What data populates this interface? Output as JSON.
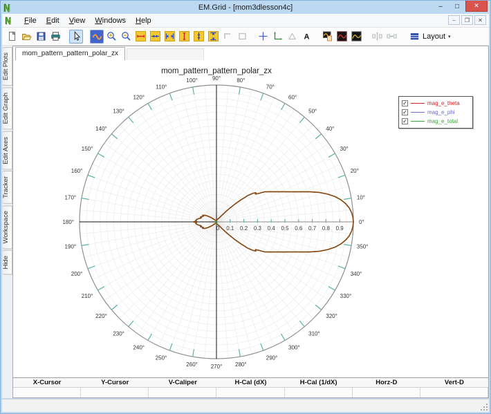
{
  "window": {
    "title": "EM.Grid - [mom3dlesson4c]"
  },
  "menu": {
    "items": [
      "File",
      "Edit",
      "View",
      "Windows",
      "Help"
    ]
  },
  "toolbar": {
    "layout_label": "Layout",
    "buttons": [
      {
        "icon": "new-document"
      },
      {
        "icon": "open-folder"
      },
      {
        "icon": "save"
      },
      {
        "icon": "print"
      },
      {
        "sep": true
      },
      {
        "icon": "pointer",
        "selected": true
      },
      {
        "sep": true
      },
      {
        "icon": "plot-trace",
        "dark": true
      },
      {
        "icon": "zoom-in"
      },
      {
        "icon": "zoom-out"
      },
      {
        "icon": "expand-x"
      },
      {
        "icon": "shrink-x"
      },
      {
        "icon": "fit-x"
      },
      {
        "icon": "expand-y"
      },
      {
        "icon": "shrink-y"
      },
      {
        "icon": "fit-y"
      },
      {
        "icon": "corner-box",
        "disabled": true
      },
      {
        "icon": "rect-box",
        "disabled": true
      },
      {
        "sep": true
      },
      {
        "icon": "crosshair"
      },
      {
        "icon": "axes"
      },
      {
        "icon": "triangle",
        "disabled": true
      },
      {
        "icon": "text-a"
      },
      {
        "sep": true
      },
      {
        "icon": "copy-plot"
      },
      {
        "icon": "plot-red"
      },
      {
        "icon": "plot-olive"
      },
      {
        "sep": true
      },
      {
        "icon": "align-v",
        "disabled": true
      },
      {
        "icon": "align-h",
        "disabled": true
      },
      {
        "sep": true
      },
      {
        "icon": "layout",
        "is_layout": true
      }
    ]
  },
  "sidebar": {
    "tabs": [
      "Edit Plots",
      "Edit Graph",
      "Edit Axes",
      "Tracker",
      "Workspace",
      "Hide"
    ]
  },
  "document_tab": {
    "label": "mom_pattern_pattern_polar_zx"
  },
  "chart_data": {
    "type": "polar",
    "title": "mom_pattern_pattern_polar_zx",
    "angle_unit": "degrees",
    "angle_tick_step_deg": 10,
    "spoke_step_deg": 5,
    "radial_range": [
      0,
      1
    ],
    "radial_grid_step": 0.05,
    "radial_tick_labels": [
      "0",
      "0.1",
      "0.2",
      "0.3",
      "0.4",
      "0.5",
      "0.6",
      "0.7",
      "0.8",
      "0.9"
    ],
    "angle_labels": [
      "0°",
      "10°",
      "20°",
      "30°",
      "40°",
      "50°",
      "60°",
      "70°",
      "80°",
      "90°",
      "100°",
      "110°",
      "120°",
      "130°",
      "140°",
      "150°",
      "160°",
      "170°",
      "180°",
      "190°",
      "200°",
      "210°",
      "220°",
      "230°",
      "240°",
      "250°",
      "260°",
      "270°",
      "280°",
      "290°",
      "300°",
      "310°",
      "320°",
      "330°",
      "340°",
      "350°"
    ],
    "grid_color": "#e9e9e9",
    "rim_color": "#8f8f8f",
    "tick_color": "#58b2a6",
    "legend": {
      "position": "top-right",
      "entries": [
        {
          "label": "mag_e_theta",
          "color": "#d42222",
          "checked": true
        },
        {
          "label": "mag_e_phi",
          "color": "#6b6bc8",
          "checked": true
        },
        {
          "label": "mag_e_total",
          "color": "#3aa33a",
          "checked": true
        }
      ]
    },
    "series": [
      {
        "name": "mag_e_total",
        "rendered_color": "#3aa33a",
        "same_points_as": "mag_e_theta"
      },
      {
        "name": "mag_e_theta",
        "rendered_color": "#8b4513",
        "symmetric_about_deg": 0,
        "points_deg_r": [
          [
            0,
            1.0
          ],
          [
            2,
            0.997
          ],
          [
            4,
            0.989
          ],
          [
            6,
            0.975
          ],
          [
            8,
            0.953
          ],
          [
            10,
            0.924
          ],
          [
            12,
            0.886
          ],
          [
            14,
            0.838
          ],
          [
            16,
            0.78
          ],
          [
            18,
            0.712
          ],
          [
            20,
            0.643
          ],
          [
            22,
            0.587
          ],
          [
            24,
            0.541
          ],
          [
            26,
            0.502
          ],
          [
            28,
            0.469
          ],
          [
            30,
            0.44
          ],
          [
            32,
            0.415
          ],
          [
            34,
            0.37
          ],
          [
            35.5,
            0.35
          ],
          [
            36.5,
            0.358
          ],
          [
            38,
            0.34
          ],
          [
            40,
            0.3
          ],
          [
            42,
            0.24
          ],
          [
            44,
            0.185
          ],
          [
            46,
            0.135
          ],
          [
            48,
            0.095
          ],
          [
            50,
            0.068
          ],
          [
            53,
            0.045
          ],
          [
            56,
            0.034
          ],
          [
            60,
            0.027
          ],
          [
            66,
            0.022
          ],
          [
            74,
            0.018
          ],
          [
            82,
            0.014
          ],
          [
            90,
            0.011
          ],
          [
            100,
            0.009
          ],
          [
            110,
            0.01
          ],
          [
            120,
            0.013
          ],
          [
            128,
            0.018
          ],
          [
            134,
            0.026
          ],
          [
            139,
            0.04
          ],
          [
            143,
            0.058
          ],
          [
            147,
            0.08
          ],
          [
            150,
            0.095
          ],
          [
            153,
            0.106
          ],
          [
            155,
            0.112
          ],
          [
            157,
            0.104
          ],
          [
            160,
            0.112
          ],
          [
            163,
            0.122
          ],
          [
            165,
            0.114
          ],
          [
            168,
            0.124
          ],
          [
            171,
            0.138
          ],
          [
            174,
            0.148
          ],
          [
            176,
            0.152
          ],
          [
            178,
            0.146
          ],
          [
            180,
            0.17
          ]
        ]
      },
      {
        "name": "mag_e_phi",
        "rendered_color": "#6b6bc8",
        "points_deg_r": [
          [
            0,
            0.005
          ],
          [
            90,
            0.005
          ],
          [
            180,
            0.005
          ],
          [
            270,
            0.005
          ]
        ]
      }
    ],
    "center_marker": {
      "color": "#1ea21e"
    }
  },
  "cursor_table": {
    "headers": [
      "X-Cursor",
      "Y-Cursor",
      "V-Caliper",
      "H-Cal (dX)",
      "H-Cal (1/dX)",
      "Horz-D",
      "Vert-D"
    ],
    "values": [
      "",
      "",
      "",
      "",
      "",
      "",
      ""
    ]
  }
}
